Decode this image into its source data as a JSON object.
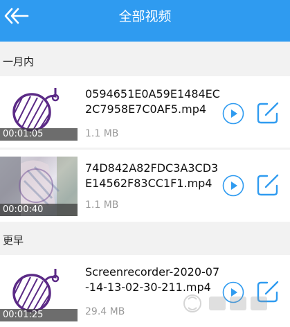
{
  "header": {
    "title": "全部视频",
    "back_icon": "double-chevron-left-icon",
    "background": "#2f9bf0"
  },
  "sections": [
    {
      "label": "一月内"
    },
    {
      "label": "更早"
    }
  ],
  "videos": [
    {
      "filename": "0594651E0A59E1484EC2C7958E7C0AF5.mp4",
      "size": "1.1 MB",
      "duration": "00:01:05",
      "thumbnail": "placeholder"
    },
    {
      "filename": "74D842A82FDC3A3CD3E14562F83CC1F1.mp4",
      "size": "1.1 MB",
      "duration": "00:00:40",
      "thumbnail": "photo"
    },
    {
      "filename": "Screenrecorder-2020-07-14-13-02-30-211.mp4",
      "size": "29.4 MB",
      "duration": "00:01:25",
      "thumbnail": "placeholder"
    }
  ],
  "accent": "#2f9bf0",
  "thumb_accent": "#5b2a86"
}
